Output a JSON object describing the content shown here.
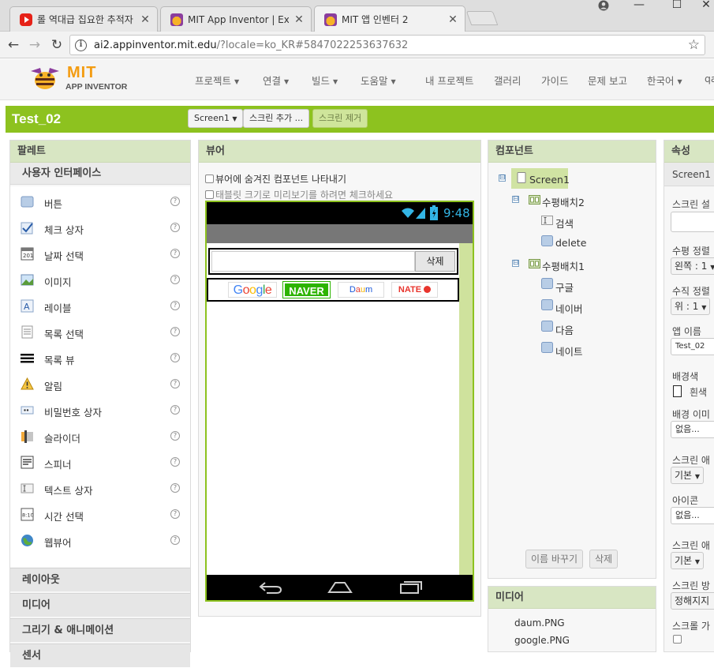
{
  "browser": {
    "tabs": [
      {
        "title": "롤 역대급 집요한 추적자",
        "favicon": "youtube-icon"
      },
      {
        "title": "MIT App Inventor | Expl",
        "favicon": "appinventor-icon"
      },
      {
        "title": "MIT 앱 인벤터 2",
        "favicon": "appinventor-icon"
      }
    ],
    "url_host": "ai2.appinventor.mit.edu",
    "url_rest": "/?locale=ko_KR#5847022253637632"
  },
  "app": {
    "logo_mit": "MIT",
    "logo_sub": "APP INVENTOR",
    "menu": [
      "프로젝트",
      "연결",
      "빌드",
      "도움말",
      "내 프로젝트",
      "갤러리",
      "가이드",
      "문제 보고",
      "한국어",
      "qa"
    ],
    "accent": "#8dc21f"
  },
  "project": {
    "title": "Test_02",
    "screen_select": "Screen1",
    "add_screen": "스크린 추가 ...",
    "remove_screen": "스크린 제거"
  },
  "palette": {
    "header": "팔레트",
    "category": "사용자 인터페이스",
    "items": [
      {
        "label": "버튼",
        "icon": "button-icon"
      },
      {
        "label": "체크 상자",
        "icon": "checkbox-icon"
      },
      {
        "label": "날짜 선택",
        "icon": "date-picker-icon"
      },
      {
        "label": "이미지",
        "icon": "image-icon"
      },
      {
        "label": "레이블",
        "icon": "label-icon"
      },
      {
        "label": "목록 선택",
        "icon": "list-picker-icon"
      },
      {
        "label": "목록 뷰",
        "icon": "list-view-icon"
      },
      {
        "label": "알림",
        "icon": "notifier-icon"
      },
      {
        "label": "비밀번호 상자",
        "icon": "password-icon"
      },
      {
        "label": "슬라이더",
        "icon": "slider-icon"
      },
      {
        "label": "스피너",
        "icon": "spinner-icon"
      },
      {
        "label": "텍스트 상자",
        "icon": "textbox-icon"
      },
      {
        "label": "시간 선택",
        "icon": "time-picker-icon"
      },
      {
        "label": "웹뷰어",
        "icon": "webviewer-icon"
      }
    ],
    "help": "?",
    "sections": [
      "레이아웃",
      "미디어",
      "그리기 & 애니메이션",
      "센서"
    ]
  },
  "viewer": {
    "header": "뷰어",
    "opt_hidden": "뷰어에 숨겨진 컴포넌트 나타내기",
    "opt_tablet": "태블릿 크기로 미리보기를 하려면 체크하세요",
    "time": "9:48",
    "delete_button": "삭제",
    "logos": [
      "Google",
      "NAVER",
      "Daum",
      "NATE"
    ]
  },
  "components": {
    "header": "컴포넌트",
    "tree": [
      {
        "label": "Screen1",
        "level": 0,
        "toggle": "⊟"
      },
      {
        "label": "수평배치2",
        "level": 1,
        "toggle": "⊟"
      },
      {
        "label": "검색",
        "level": 2
      },
      {
        "label": "delete",
        "level": 2
      },
      {
        "label": "수평배치1",
        "level": 1,
        "toggle": "⊟"
      },
      {
        "label": "구글",
        "level": 2
      },
      {
        "label": "네이버",
        "level": 2
      },
      {
        "label": "다음",
        "level": 2
      },
      {
        "label": "네이트",
        "level": 2
      }
    ],
    "rename": "이름 바꾸기",
    "delete": "삭제"
  },
  "media": {
    "header": "미디어",
    "files": [
      "daum.PNG",
      "google.PNG"
    ]
  },
  "properties": {
    "header": "속성",
    "component": "Screen1",
    "rows": {
      "about_label": "스크린 설",
      "halign_label": "수평 정렬",
      "halign_value": "왼쪽 : 1",
      "valign_label": "수직 정렬",
      "valign_value": "위 : 1",
      "appname_label": "앱 이름",
      "appname_value": "Test_02",
      "bg_label": "배경색",
      "bg_value": "흰색",
      "bgimg_label": "배경 이미",
      "bgimg_value": "없음...",
      "anim_label": "스크린 애",
      "anim_value": "기본",
      "icon_label": "아이콘",
      "icon_value": "없음...",
      "anim2_label": "스크린 애",
      "anim2_value": "기본",
      "orient_label": "스크린 방",
      "orient_value": "정해지지",
      "scroll_label": "스크롤 가"
    }
  }
}
